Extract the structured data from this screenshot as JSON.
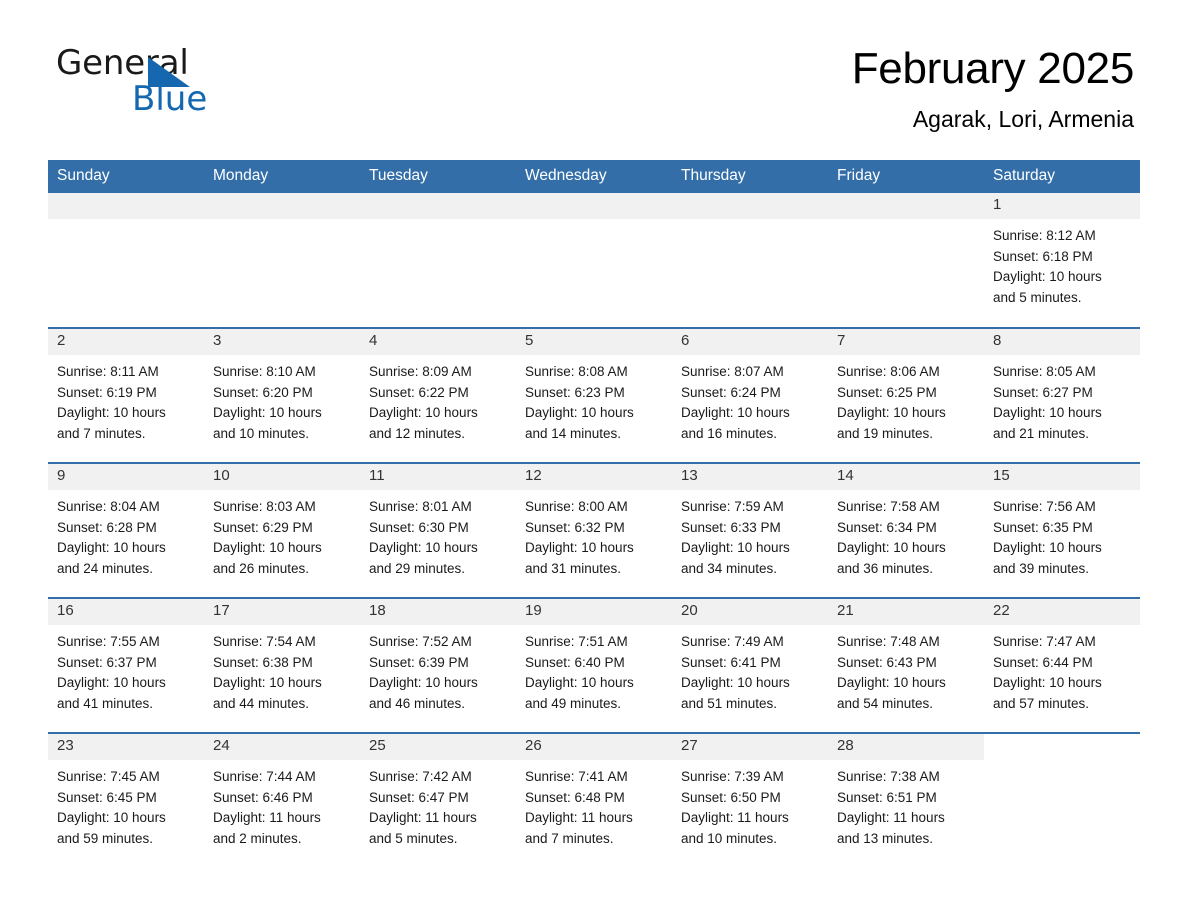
{
  "brand": {
    "name_part1": "General",
    "name_part2": "Blue",
    "accent_color": "#1568b0",
    "logo_icon": "triangle-flag-icon"
  },
  "header": {
    "title": "February 2025",
    "subtitle": "Agarak, Lori, Armenia"
  },
  "calendar": {
    "header_bg": "#336ea8",
    "daynum_bg": "#f1f1f1",
    "weekday_headers": [
      "Sunday",
      "Monday",
      "Tuesday",
      "Wednesday",
      "Thursday",
      "Friday",
      "Saturday"
    ],
    "weeks": [
      [
        {
          "day": "",
          "sunrise": "",
          "sunset": "",
          "daylight1": "",
          "daylight2": "",
          "blank": true
        },
        {
          "day": "",
          "sunrise": "",
          "sunset": "",
          "daylight1": "",
          "daylight2": "",
          "blank": true
        },
        {
          "day": "",
          "sunrise": "",
          "sunset": "",
          "daylight1": "",
          "daylight2": "",
          "blank": true
        },
        {
          "day": "",
          "sunrise": "",
          "sunset": "",
          "daylight1": "",
          "daylight2": "",
          "blank": true
        },
        {
          "day": "",
          "sunrise": "",
          "sunset": "",
          "daylight1": "",
          "daylight2": "",
          "blank": true
        },
        {
          "day": "",
          "sunrise": "",
          "sunset": "",
          "daylight1": "",
          "daylight2": "",
          "blank": true
        },
        {
          "day": "1",
          "sunrise": "Sunrise: 8:12 AM",
          "sunset": "Sunset: 6:18 PM",
          "daylight1": "Daylight: 10 hours",
          "daylight2": "and 5 minutes."
        }
      ],
      [
        {
          "day": "2",
          "sunrise": "Sunrise: 8:11 AM",
          "sunset": "Sunset: 6:19 PM",
          "daylight1": "Daylight: 10 hours",
          "daylight2": "and 7 minutes."
        },
        {
          "day": "3",
          "sunrise": "Sunrise: 8:10 AM",
          "sunset": "Sunset: 6:20 PM",
          "daylight1": "Daylight: 10 hours",
          "daylight2": "and 10 minutes."
        },
        {
          "day": "4",
          "sunrise": "Sunrise: 8:09 AM",
          "sunset": "Sunset: 6:22 PM",
          "daylight1": "Daylight: 10 hours",
          "daylight2": "and 12 minutes."
        },
        {
          "day": "5",
          "sunrise": "Sunrise: 8:08 AM",
          "sunset": "Sunset: 6:23 PM",
          "daylight1": "Daylight: 10 hours",
          "daylight2": "and 14 minutes."
        },
        {
          "day": "6",
          "sunrise": "Sunrise: 8:07 AM",
          "sunset": "Sunset: 6:24 PM",
          "daylight1": "Daylight: 10 hours",
          "daylight2": "and 16 minutes."
        },
        {
          "day": "7",
          "sunrise": "Sunrise: 8:06 AM",
          "sunset": "Sunset: 6:25 PM",
          "daylight1": "Daylight: 10 hours",
          "daylight2": "and 19 minutes."
        },
        {
          "day": "8",
          "sunrise": "Sunrise: 8:05 AM",
          "sunset": "Sunset: 6:27 PM",
          "daylight1": "Daylight: 10 hours",
          "daylight2": "and 21 minutes."
        }
      ],
      [
        {
          "day": "9",
          "sunrise": "Sunrise: 8:04 AM",
          "sunset": "Sunset: 6:28 PM",
          "daylight1": "Daylight: 10 hours",
          "daylight2": "and 24 minutes."
        },
        {
          "day": "10",
          "sunrise": "Sunrise: 8:03 AM",
          "sunset": "Sunset: 6:29 PM",
          "daylight1": "Daylight: 10 hours",
          "daylight2": "and 26 minutes."
        },
        {
          "day": "11",
          "sunrise": "Sunrise: 8:01 AM",
          "sunset": "Sunset: 6:30 PM",
          "daylight1": "Daylight: 10 hours",
          "daylight2": "and 29 minutes."
        },
        {
          "day": "12",
          "sunrise": "Sunrise: 8:00 AM",
          "sunset": "Sunset: 6:32 PM",
          "daylight1": "Daylight: 10 hours",
          "daylight2": "and 31 minutes."
        },
        {
          "day": "13",
          "sunrise": "Sunrise: 7:59 AM",
          "sunset": "Sunset: 6:33 PM",
          "daylight1": "Daylight: 10 hours",
          "daylight2": "and 34 minutes."
        },
        {
          "day": "14",
          "sunrise": "Sunrise: 7:58 AM",
          "sunset": "Sunset: 6:34 PM",
          "daylight1": "Daylight: 10 hours",
          "daylight2": "and 36 minutes."
        },
        {
          "day": "15",
          "sunrise": "Sunrise: 7:56 AM",
          "sunset": "Sunset: 6:35 PM",
          "daylight1": "Daylight: 10 hours",
          "daylight2": "and 39 minutes."
        }
      ],
      [
        {
          "day": "16",
          "sunrise": "Sunrise: 7:55 AM",
          "sunset": "Sunset: 6:37 PM",
          "daylight1": "Daylight: 10 hours",
          "daylight2": "and 41 minutes."
        },
        {
          "day": "17",
          "sunrise": "Sunrise: 7:54 AM",
          "sunset": "Sunset: 6:38 PM",
          "daylight1": "Daylight: 10 hours",
          "daylight2": "and 44 minutes."
        },
        {
          "day": "18",
          "sunrise": "Sunrise: 7:52 AM",
          "sunset": "Sunset: 6:39 PM",
          "daylight1": "Daylight: 10 hours",
          "daylight2": "and 46 minutes."
        },
        {
          "day": "19",
          "sunrise": "Sunrise: 7:51 AM",
          "sunset": "Sunset: 6:40 PM",
          "daylight1": "Daylight: 10 hours",
          "daylight2": "and 49 minutes."
        },
        {
          "day": "20",
          "sunrise": "Sunrise: 7:49 AM",
          "sunset": "Sunset: 6:41 PM",
          "daylight1": "Daylight: 10 hours",
          "daylight2": "and 51 minutes."
        },
        {
          "day": "21",
          "sunrise": "Sunrise: 7:48 AM",
          "sunset": "Sunset: 6:43 PM",
          "daylight1": "Daylight: 10 hours",
          "daylight2": "and 54 minutes."
        },
        {
          "day": "22",
          "sunrise": "Sunrise: 7:47 AM",
          "sunset": "Sunset: 6:44 PM",
          "daylight1": "Daylight: 10 hours",
          "daylight2": "and 57 minutes."
        }
      ],
      [
        {
          "day": "23",
          "sunrise": "Sunrise: 7:45 AM",
          "sunset": "Sunset: 6:45 PM",
          "daylight1": "Daylight: 10 hours",
          "daylight2": "and 59 minutes."
        },
        {
          "day": "24",
          "sunrise": "Sunrise: 7:44 AM",
          "sunset": "Sunset: 6:46 PM",
          "daylight1": "Daylight: 11 hours",
          "daylight2": "and 2 minutes."
        },
        {
          "day": "25",
          "sunrise": "Sunrise: 7:42 AM",
          "sunset": "Sunset: 6:47 PM",
          "daylight1": "Daylight: 11 hours",
          "daylight2": "and 5 minutes."
        },
        {
          "day": "26",
          "sunrise": "Sunrise: 7:41 AM",
          "sunset": "Sunset: 6:48 PM",
          "daylight1": "Daylight: 11 hours",
          "daylight2": "and 7 minutes."
        },
        {
          "day": "27",
          "sunrise": "Sunrise: 7:39 AM",
          "sunset": "Sunset: 6:50 PM",
          "daylight1": "Daylight: 11 hours",
          "daylight2": "and 10 minutes."
        },
        {
          "day": "28",
          "sunrise": "Sunrise: 7:38 AM",
          "sunset": "Sunset: 6:51 PM",
          "daylight1": "Daylight: 11 hours",
          "daylight2": "and 13 minutes."
        },
        {
          "day": "",
          "sunrise": "",
          "sunset": "",
          "daylight1": "",
          "daylight2": "",
          "blank": true
        }
      ]
    ]
  }
}
